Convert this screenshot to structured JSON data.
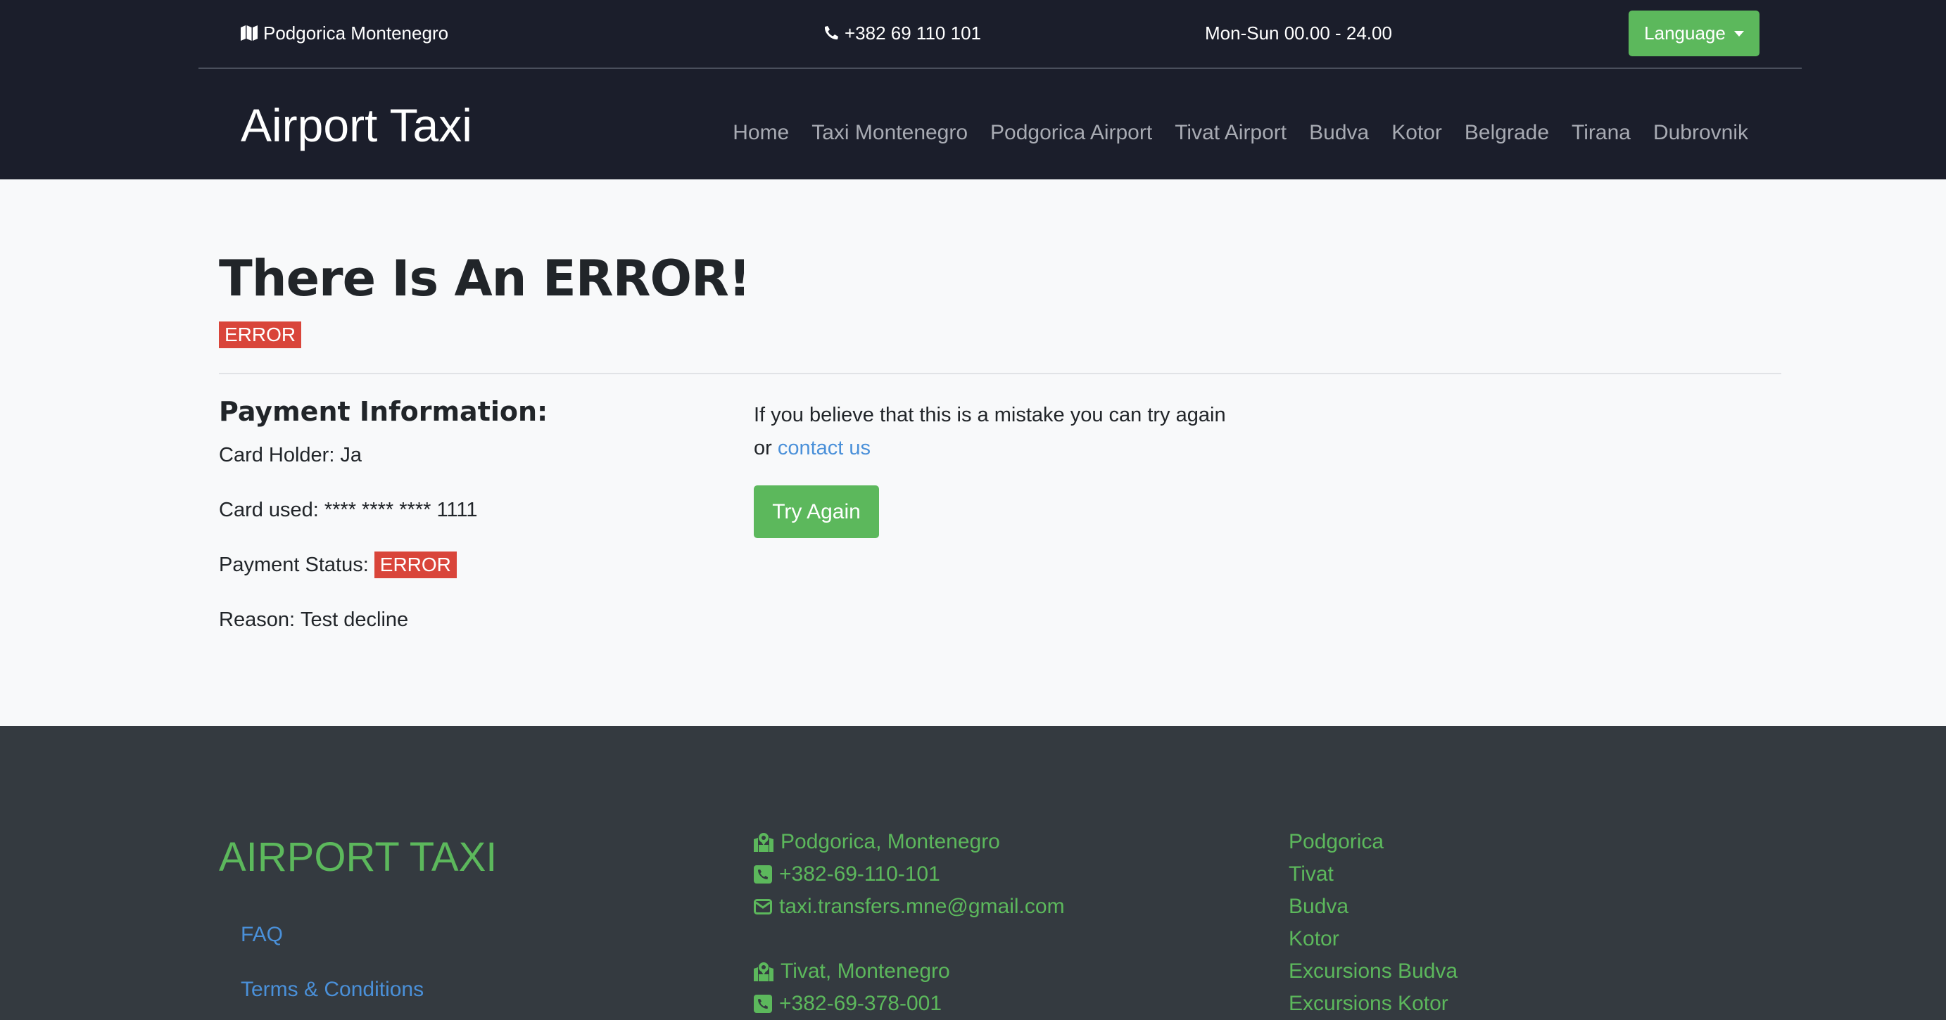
{
  "topbar": {
    "location": "Podgorica Montenegro",
    "phone": "+382 69 110 101",
    "hours": "Mon-Sun 00.00 - 24.00",
    "language_label": "Language"
  },
  "navbar": {
    "brand": "Airport Taxi",
    "items": [
      "Home",
      "Taxi Montenegro",
      "Podgorica Airport",
      "Tivat Airport",
      "Budva",
      "Kotor",
      "Belgrade",
      "Tirana",
      "Dubrovnik"
    ]
  },
  "main": {
    "title": "There Is An ERROR!",
    "status_badge": "ERROR",
    "payment": {
      "heading": "Payment Information:",
      "card_holder_label": "Card Holder:",
      "card_holder": "Ja",
      "card_used_label": "Card used:",
      "card_used": "**** **** **** 1111",
      "status_label": "Payment Status:",
      "status": "ERROR",
      "reason_label": "Reason:",
      "reason": "Test decline"
    },
    "message": {
      "line1": "If you believe that this is a mistake you can try again",
      "line2_prefix": "or",
      "contact_link": "contact us"
    },
    "try_again_label": "Try Again"
  },
  "footer": {
    "brand": "AIRPORT TAXI",
    "links": [
      "FAQ",
      "Terms & Conditions"
    ],
    "contacts": {
      "podgorica_address": "Podgorica, Montenegro",
      "podgorica_phone": "+382-69-110-101",
      "email": "taxi.transfers.mne@gmail.com",
      "tivat_address": "Tivat, Montenegro",
      "tivat_phone": "+382-69-378-001"
    },
    "cities": [
      "Podgorica",
      "Tivat",
      "Budva",
      "Kotor",
      "Excursions Budva",
      "Excursions Kotor"
    ]
  },
  "colors": {
    "header_bg": "#1b1e2b",
    "accent_green": "#5cb85c",
    "error_red": "#d9453a",
    "link_blue": "#4a90d9",
    "footer_bg": "#343a40"
  }
}
